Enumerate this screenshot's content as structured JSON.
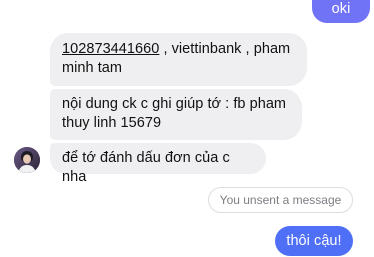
{
  "messages": {
    "oki": "oki",
    "account_number": "102873441660",
    "account_rest_line1": " , viettinbank , pham",
    "account_line2": "minh tam",
    "content_line1": "nội dung ck c ghi giúp tớ : fb pham",
    "content_line2": "thuy linh 15679",
    "mark_order": "để tớ đánh dấu đơn của c nha",
    "unsent_notice": "You unsent a message",
    "thoi_cau": "thôi cậu!"
  },
  "colors": {
    "outgoing_bubble": "#5a8af9",
    "incoming_bubble": "#efeff1",
    "unsent_text": "#7d7e84"
  },
  "icons": {
    "contact_avatar": "avatar"
  }
}
